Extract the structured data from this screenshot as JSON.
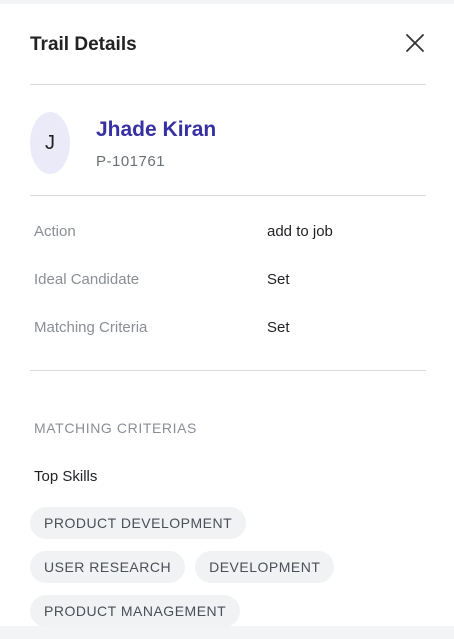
{
  "header": {
    "title": "Trail Details"
  },
  "candidate": {
    "initial": "J",
    "name": "Jhade Kiran",
    "id": "P-101761"
  },
  "details": [
    {
      "label": "Action",
      "value": "add to job"
    },
    {
      "label": "Ideal Candidate",
      "value": "Set"
    },
    {
      "label": "Matching Criteria",
      "value": "Set"
    }
  ],
  "matching": {
    "section_title": "MATCHING CRITERIAS",
    "skills_title": "Top Skills",
    "skills": [
      "PRODUCT DEVELOPMENT",
      "USER RESEARCH",
      "DEVELOPMENT",
      "PRODUCT MANAGEMENT"
    ]
  },
  "colors": {
    "name": "#3730a3",
    "avatar_bg": "#ebeaf8",
    "chip_bg": "#f1f2f4"
  }
}
